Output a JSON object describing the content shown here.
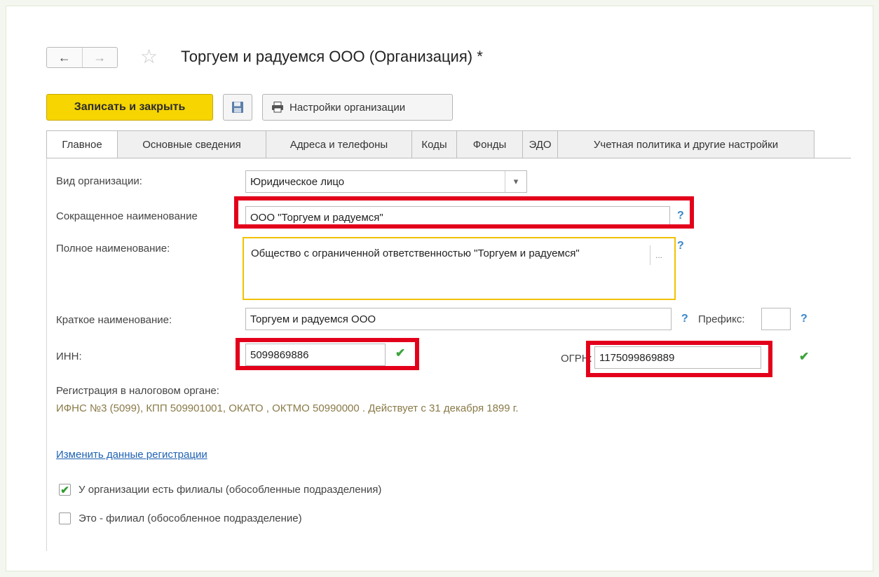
{
  "window": {
    "title": "Торгуем и радуемся ООО (Организация) *",
    "back_icon": "←",
    "forward_icon": "→",
    "star_icon": "☆"
  },
  "toolbar": {
    "save_close_label": "Записать и закрыть",
    "save_icon": "floppy-disk",
    "settings_label": "Настройки организации"
  },
  "tabs": [
    {
      "label": "Главное"
    },
    {
      "label": "Основные сведения"
    },
    {
      "label": "Адреса и телефоны"
    },
    {
      "label": "Коды"
    },
    {
      "label": "Фонды"
    },
    {
      "label": "ЭДО"
    },
    {
      "label": "Учетная политика и другие настройки"
    }
  ],
  "form": {
    "org_type_label": "Вид организации:",
    "org_type_value": "Юридическое лицо",
    "short_name_label": "Сокращенное наименование",
    "short_name_value": "ООО \"Торгуем и радуемся\"",
    "full_name_label": "Полное наименование:",
    "full_name_value": "Общество с ограниченной ответственностью \"Торгуем и радуемся\"",
    "brief_name_label": "Краткое наименование:",
    "brief_name_value": "Торгуем и радуемся ООО",
    "prefix_label": "Префикс:",
    "prefix_value": "",
    "inn_label": "ИНН:",
    "inn_value": "5099869886",
    "ogrn_label": "ОГРН:",
    "ogrn_value": "1175099869889",
    "help": "?",
    "ellipsis": "...",
    "dropdown_arrow": "▾",
    "valid_mark": "✔"
  },
  "registration": {
    "label": "Регистрация в налоговом органе:",
    "details": "ИФНС №3 (5099), КПП 509901001, ОКАТО , ОКТМО 50990000   . Действует с 31 декабря 1899 г.",
    "change_link": "Изменить данные регистрации"
  },
  "checkboxes": [
    {
      "label": "У организации есть филиалы (обособленные подразделения)",
      "checked": true,
      "mark": "✔"
    },
    {
      "label": "Это - филиал (обособленное подразделение)",
      "checked": false,
      "mark": ""
    }
  ],
  "colors": {
    "highlight": "#e3001b",
    "primary_button": "#f6d500",
    "active_field_border": "#f2c200",
    "valid_check": "#3aa43a",
    "help_icon": "#3a86c8"
  }
}
